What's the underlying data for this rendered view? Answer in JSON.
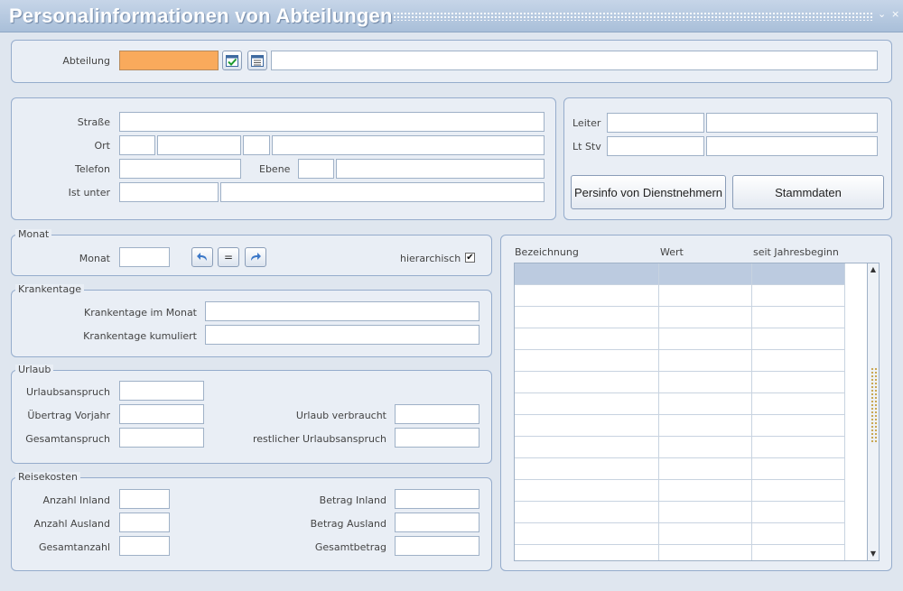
{
  "window": {
    "title": "Personalinformationen von Abteilungen",
    "controls": {
      "minimize": "⌄",
      "close": "×"
    }
  },
  "abteilung": {
    "label": "Abteilung",
    "code": "",
    "name": ""
  },
  "address": {
    "strasse_label": "Straße",
    "strasse": "",
    "ort_label": "Ort",
    "ort_1": "",
    "ort_2": "",
    "ort_3": "",
    "ort_4": "",
    "telefon_label": "Telefon",
    "telefon": "",
    "ebene_label": "Ebene",
    "ebene_1": "",
    "ebene_2": "",
    "ist_unter_label": "Ist unter",
    "ist_unter_1": "",
    "ist_unter_2": ""
  },
  "leitung": {
    "leiter_label": "Leiter",
    "leiter_1": "",
    "leiter_2": "",
    "ltstv_label": "Lt Stv",
    "ltstv_1": "",
    "ltstv_2": "",
    "persinfo_button": "Persinfo von Dienstnehmern",
    "stammdaten_button": "Stammdaten"
  },
  "monat": {
    "legend": "Monat",
    "label": "Monat",
    "value": "",
    "nav_equal": "=",
    "hierarchisch_label": "hierarchisch",
    "hierarchisch_checked": "✔"
  },
  "krankentage": {
    "legend": "Krankentage",
    "im_monat_label": "Krankentage im Monat",
    "im_monat": "",
    "kumuliert_label": "Krankentage kumuliert",
    "kumuliert": ""
  },
  "urlaub": {
    "legend": "Urlaub",
    "anspruch_label": "Urlaubsanspruch",
    "anspruch": "",
    "uebertrag_label": "Übertrag Vorjahr",
    "uebertrag": "",
    "gesamt_label": "Gesamtanspruch",
    "gesamt": "",
    "verbraucht_label": "Urlaub verbraucht",
    "verbraucht": "",
    "rest_label": "restlicher Urlaubsanspruch",
    "rest": ""
  },
  "reisekosten": {
    "legend": "Reisekosten",
    "anzahl_inland_label": "Anzahl Inland",
    "anzahl_inland": "",
    "anzahl_ausland_label": "Anzahl Ausland",
    "anzahl_ausland": "",
    "gesamtanzahl_label": "Gesamtanzahl",
    "gesamtanzahl": "",
    "betrag_inland_label": "Betrag Inland",
    "betrag_inland": "",
    "betrag_ausland_label": "Betrag Ausland",
    "betrag_ausland": "",
    "gesamtbetrag_label": "Gesamtbetrag",
    "gesamtbetrag": ""
  },
  "table": {
    "columns": [
      "Bezeichnung",
      "Wert",
      "seit Jahresbeginn"
    ],
    "rows": [
      [
        "",
        "",
        ""
      ],
      [
        "",
        "",
        ""
      ],
      [
        "",
        "",
        ""
      ],
      [
        "",
        "",
        ""
      ],
      [
        "",
        "",
        ""
      ],
      [
        "",
        "",
        ""
      ],
      [
        "",
        "",
        ""
      ],
      [
        "",
        "",
        ""
      ],
      [
        "",
        "",
        ""
      ],
      [
        "",
        "",
        ""
      ],
      [
        "",
        "",
        ""
      ],
      [
        "",
        "",
        ""
      ],
      [
        "",
        "",
        ""
      ],
      [
        "",
        "",
        ""
      ]
    ]
  },
  "colors": {
    "accent_field": "#f9aa5c",
    "panel_bg": "#e9eef5",
    "border": "#95accc",
    "selected_row": "#bccbe0"
  }
}
